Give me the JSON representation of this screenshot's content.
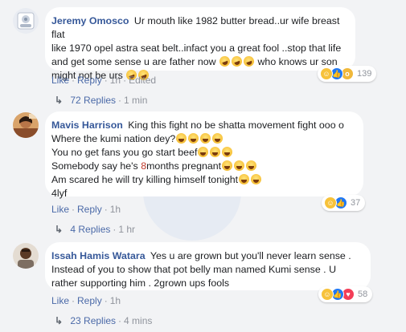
{
  "comments": [
    {
      "author": "Jeremy Omosco",
      "lines": [
        "Ur mouth like 1982 butter bread..ur wife breast flat",
        "like 1970 opel astra seat belt..infact you a great fool ..stop that life",
        "and get some sense u are father now",
        "who knows ur son",
        "might not be urs"
      ],
      "actions": {
        "like": "Like",
        "reply": "Reply",
        "time": "1h",
        "edited": "Edited"
      },
      "replies": {
        "label": "72 Replies",
        "ago": "1 min"
      },
      "reactions": {
        "icons": [
          "haha-icon",
          "like-icon",
          "wow-icon"
        ],
        "count": "139"
      }
    },
    {
      "author": "Mavis Harrison",
      "lines": [
        "King this fight no be shatta movement fight ooo o",
        "Where the kumi nation dey?",
        "You no get fans you go start beef",
        "Somebody say he's ",
        "8",
        "months pregnant",
        "Am scared he will try killing himself tonight",
        "4lyf"
      ],
      "actions": {
        "like": "Like",
        "reply": "Reply",
        "time": "1h"
      },
      "replies": {
        "label": "4 Replies",
        "ago": "1 hr"
      },
      "reactions": {
        "icons": [
          "haha-icon",
          "like-icon"
        ],
        "count": "37"
      }
    },
    {
      "author": "Issah Hamis Watara",
      "lines": [
        "Yes u are grown but you'll never learn sense .",
        "Instead of you to show that pot belly man named Kumi sense . U",
        "rather supporting him . 2grown ups fools"
      ],
      "actions": {
        "like": "Like",
        "reply": "Reply",
        "time": "1h"
      },
      "replies": {
        "label": "23 Replies",
        "ago": "4 mins"
      },
      "reactions": {
        "icons": [
          "haha-icon",
          "like-icon",
          "love-icon"
        ],
        "count": "58"
      }
    }
  ],
  "colors": {
    "background": "#f2f3f5",
    "bubble": "#ffffff",
    "author": "#365899",
    "link": "#4b6aa8",
    "meta": "#90949c"
  },
  "separators": {
    "dot": "·",
    "arrow": "↳"
  }
}
